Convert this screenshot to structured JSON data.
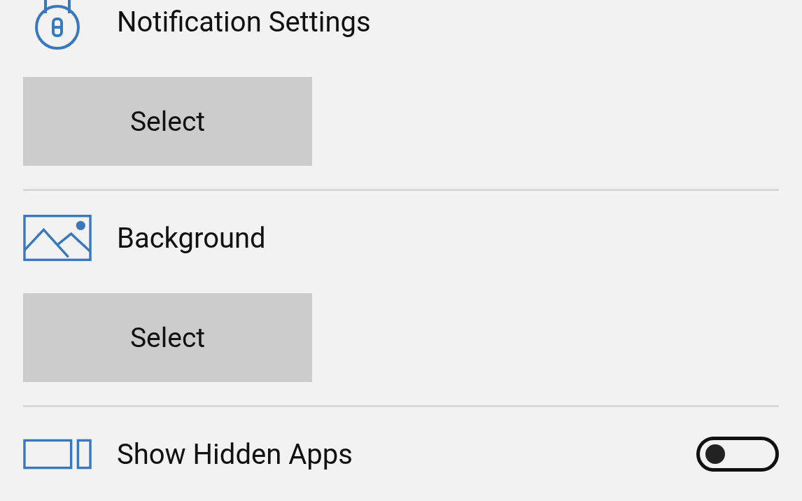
{
  "settings": [
    {
      "kind": "select",
      "label": "Notification Settings",
      "button": "Select"
    },
    {
      "kind": "select",
      "label": "Background",
      "button": "Select"
    },
    {
      "kind": "toggle",
      "label": "Show Hidden Apps",
      "on": false
    }
  ]
}
